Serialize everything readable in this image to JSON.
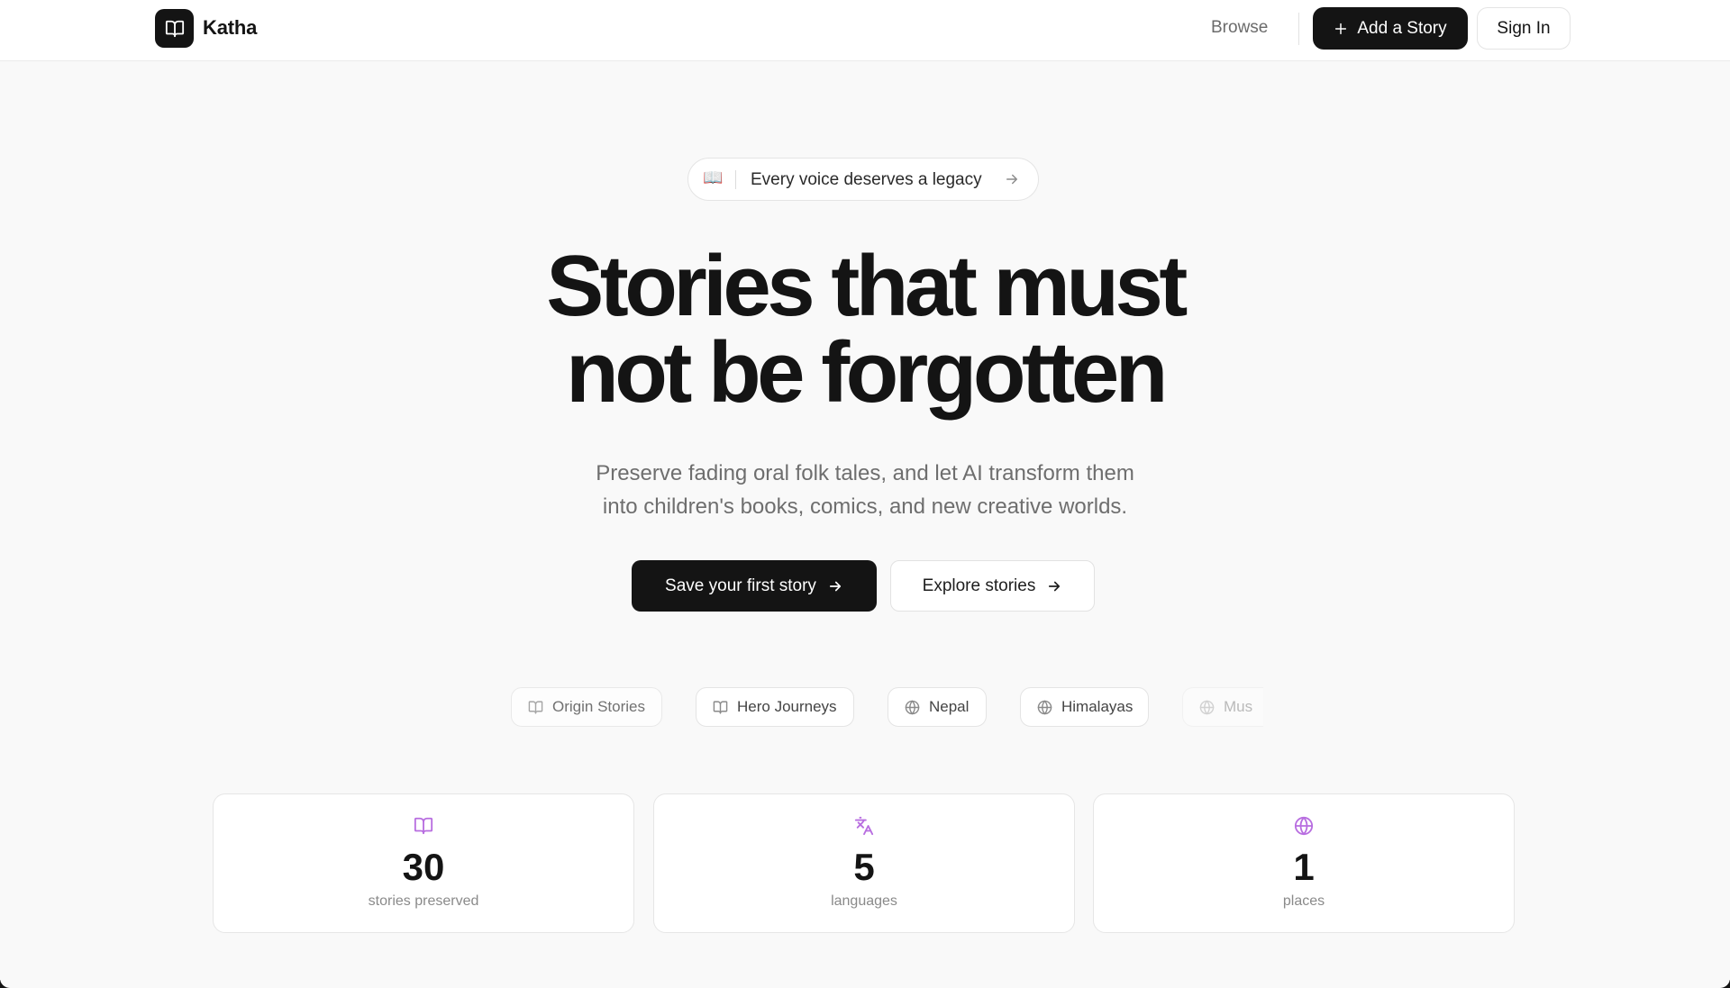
{
  "header": {
    "app_name": "Katha",
    "nav_browse": "Browse",
    "add_story_label": "Add a Story",
    "sign_in_label": "Sign In"
  },
  "hero": {
    "pill_text": "Every voice deserves a legacy",
    "headline_line1": "Stories that must",
    "headline_line2": "not be forgotten",
    "subtitle_line1": "Preserve fading oral folk tales, and let AI transform them",
    "subtitle_line2": "into children's books, comics, and new creative worlds.",
    "primary_cta": "Save your first story",
    "secondary_cta": "Explore stories"
  },
  "tags": [
    {
      "label": "Origin Stories",
      "icon": "book-icon"
    },
    {
      "label": "Hero Journeys",
      "icon": "book-icon"
    },
    {
      "label": "Nepal",
      "icon": "globe-icon"
    },
    {
      "label": "Himalayas",
      "icon": "globe-icon"
    },
    {
      "label": "Mus",
      "icon": "globe-icon"
    }
  ],
  "stats": [
    {
      "value": "30",
      "label": "stories preserved",
      "icon": "book-icon"
    },
    {
      "value": "5",
      "label": "languages",
      "icon": "translate-icon"
    },
    {
      "value": "1",
      "label": "places",
      "icon": "globe-icon"
    }
  ],
  "colors": {
    "accent_purple": "#b86ee0",
    "primary_dark": "#141414",
    "background": "#f9f9f9"
  }
}
